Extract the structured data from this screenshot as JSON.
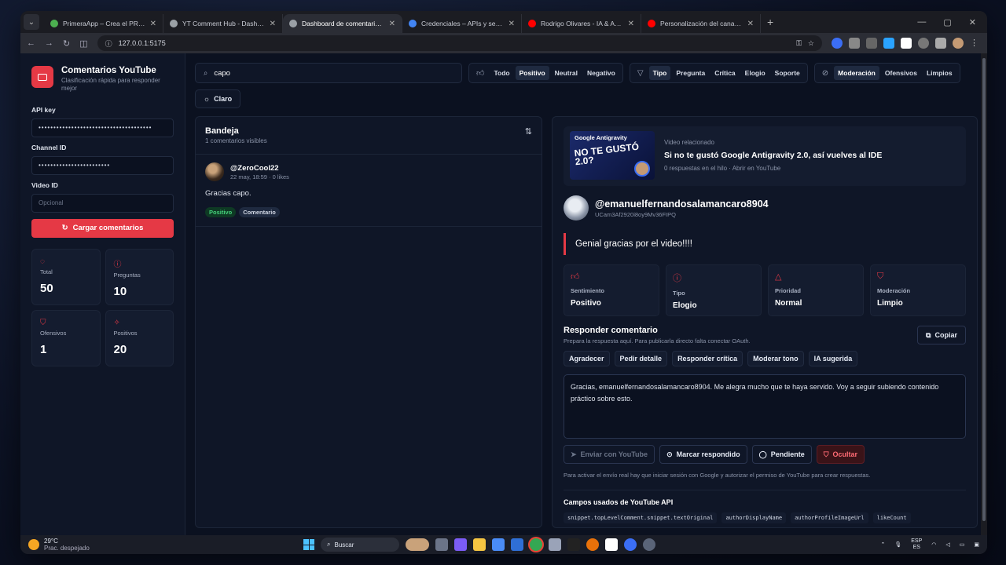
{
  "browser": {
    "tabs": [
      {
        "title": "PrimeraApp – Crea el PRD y Pr…",
        "color": "#4caf50",
        "active": false
      },
      {
        "title": "YT Comment Hub - Dashboard",
        "color": "#9aa0a6",
        "active": false
      },
      {
        "title": "Dashboard de comentarios de",
        "color": "#9aa0a6",
        "active": true
      },
      {
        "title": "Credenciales – APIs y servicios",
        "color": "#4285f4",
        "active": false
      },
      {
        "title": "Rodrigo Olivares - IA & Apps W…",
        "color": "#ff0000",
        "active": false
      },
      {
        "title": "Personalización del canal - You…",
        "color": "#ff0000",
        "active": false
      }
    ],
    "url": "127.0.0.1:5175"
  },
  "sidebar": {
    "title": "Comentarios YouTube",
    "subtitle": "Clasificación rápida para responder mejor",
    "api_key_label": "API key",
    "api_key_value": "••••••••••••••••••••••••••••••••••••••",
    "channel_label": "Channel ID",
    "channel_value": "••••••••••••••••••••••••",
    "video_label": "Video ID",
    "video_placeholder": "Opcional",
    "load_button": "Cargar comentarios",
    "stats": [
      {
        "icon": "chat-icon",
        "label": "Total",
        "value": "50"
      },
      {
        "icon": "question-icon",
        "label": "Preguntas",
        "value": "10"
      },
      {
        "icon": "shield-icon",
        "label": "Ofensivos",
        "value": "1"
      },
      {
        "icon": "sparkle-icon",
        "label": "Positivos",
        "value": "20"
      }
    ]
  },
  "toolbar": {
    "search_value": "capo",
    "sentiment": {
      "options": [
        "Todo",
        "Positivo",
        "Neutral",
        "Negativo"
      ],
      "selected": "Positivo"
    },
    "type": {
      "options": [
        "Tipo",
        "Pregunta",
        "Crítica",
        "Elogio",
        "Soporte"
      ],
      "selected": "Tipo"
    },
    "moderation": {
      "options": [
        "Moderación",
        "Ofensivos",
        "Limpios"
      ],
      "selected": "Moderación"
    },
    "theme_button": "Claro"
  },
  "inbox": {
    "title": "Bandeja",
    "count_text": "1 comentarios visibles",
    "comments": [
      {
        "author": "@ZeroCool22",
        "meta": "22 may, 18:59 · 0 likes",
        "text": "Gracias capo.",
        "tags": [
          "Positivo",
          "Comentario"
        ]
      }
    ]
  },
  "detail": {
    "video_thumb_brand": "Google Antigravity",
    "video_thumb_text": "NO TE GUSTÓ 2.0?",
    "video_related_label": "Video relacionado",
    "video_title": "Si no te gustó Google Antigravity 2.0, así vuelves al IDE",
    "video_meta": "0 respuestas en el hilo · Abrir en YouTube",
    "author": "@emanuelfernandosalamancaro8904",
    "author_id": "UCam3Af2920i8oy9Mv36FIPQ",
    "comment": "Genial gracias por el video!!!!",
    "cards": [
      {
        "icon": "thumbs-up-icon",
        "label": "Sentimiento",
        "value": "Positivo"
      },
      {
        "icon": "question-icon",
        "label": "Tipo",
        "value": "Elogio"
      },
      {
        "icon": "alert-icon",
        "label": "Prioridad",
        "value": "Normal"
      },
      {
        "icon": "shield-icon",
        "label": "Moderación",
        "value": "Limpio"
      }
    ],
    "reply_title": "Responder comentario",
    "reply_sub": "Prepara la respuesta aquí. Para publicarla directo falta conectar OAuth.",
    "copy_button": "Copiar",
    "chips": [
      "Agradecer",
      "Pedir detalle",
      "Responder crítica",
      "Moderar tono",
      "IA sugerida"
    ],
    "reply_text": "Gracias, emanuelfernandosalamancaro8904. Me alegra mucho que te haya servido. Voy a seguir subiendo contenido práctico sobre esto.",
    "actions": {
      "send": "Enviar con YouTube",
      "mark": "Marcar respondido",
      "pending": "Pendiente",
      "hide": "Ocultar"
    },
    "hint": "Para activar el envío real hay que iniciar sesión con Google y autorizar el permiso de YouTube para crear respuestas.",
    "fields_title": "Campos usados de YouTube API",
    "fields": [
      "snippet.topLevelComment.snippet.textOriginal",
      "authorDisplayName",
      "authorProfileImageUrl",
      "likeCount"
    ]
  },
  "taskbar": {
    "temp": "29°C",
    "weather": "Prac. despejado",
    "search": "Buscar",
    "lang1": "ESP",
    "lang2": "ES"
  }
}
